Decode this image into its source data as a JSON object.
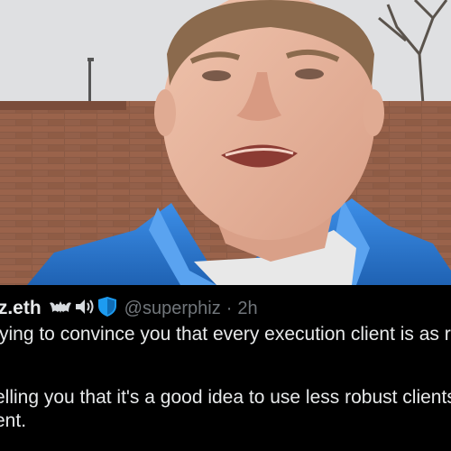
{
  "tweet": {
    "display_name": "iz.eth",
    "handle": "@superphiz",
    "separator": "·",
    "timestamp": "2h",
    "emoji_icons": [
      "bat-icon",
      "speaker-icon",
      "shield-icon"
    ],
    "text_line_1": "rying to convince you that every execution client is as rob",
    "text_line_2": "elling you that it's a good idea to use less robust clients t",
    "text_line_3": "ent."
  },
  "colors": {
    "background": "#000000",
    "text": "#e7e9ea",
    "secondary_text": "#71767b",
    "shield": "#1d9bf0",
    "jacket": "#2f7fd6"
  }
}
